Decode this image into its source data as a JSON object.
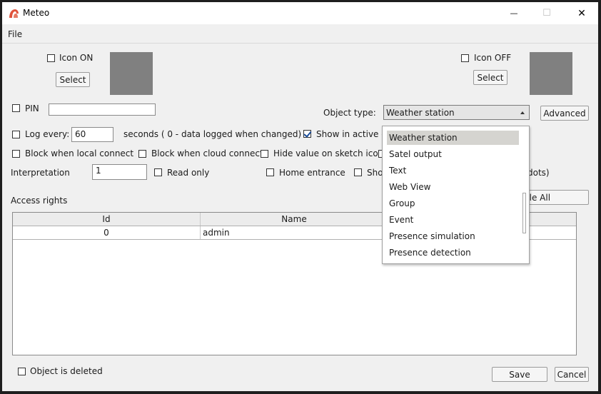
{
  "window": {
    "title": "Meteo",
    "min_glyph": "—",
    "max_glyph": "☐",
    "close_glyph": "✕"
  },
  "menu": {
    "file": "File"
  },
  "icon_on": {
    "label": "Icon ON",
    "select_label": "Select",
    "checked": false
  },
  "icon_off": {
    "label": "Icon OFF",
    "select_label": "Select",
    "checked": false
  },
  "pin": {
    "label": "PIN",
    "value": ""
  },
  "object_type": {
    "label": "Object type:",
    "value": "Weather station",
    "advanced_label": "Advanced"
  },
  "log": {
    "label": "Log every:",
    "value": "60",
    "suffix": "seconds ( 0 - data logged when changed)"
  },
  "show_active": {
    "label": "Show in active d"
  },
  "block_local": {
    "label": "Block when local connect"
  },
  "block_cloud": {
    "label": "Block when cloud connect"
  },
  "hide_value": {
    "label": "Hide value on sketch icon"
  },
  "interpretation": {
    "label": "Interpretation",
    "value": "1"
  },
  "read_only": {
    "label": "Read only"
  },
  "home_entrance": {
    "label": "Home entrance"
  },
  "sho_partial": {
    "label": "Sho"
  },
  "dots_partial": {
    "label": "dots)"
  },
  "toggle_all": {
    "label": "gle All"
  },
  "access_rights": {
    "label": "Access rights"
  },
  "table": {
    "headers": [
      "Id",
      "Name"
    ],
    "rows": [
      {
        "id": "0",
        "name": "admin"
      }
    ]
  },
  "dropdown": {
    "items": [
      "Weather station",
      "Satel output",
      "Text",
      "Web View",
      "Group",
      "Event",
      "Presence simulation",
      "Presence detection"
    ],
    "selected_index": 0
  },
  "deleted": {
    "label": "Object is deleted"
  },
  "footer": {
    "save_label": "Save",
    "cancel_label": "Cancel"
  },
  "colors": {
    "accent_icon": "#e0523b",
    "swatch": "#808080",
    "selected_item": "#d5d4d0"
  }
}
